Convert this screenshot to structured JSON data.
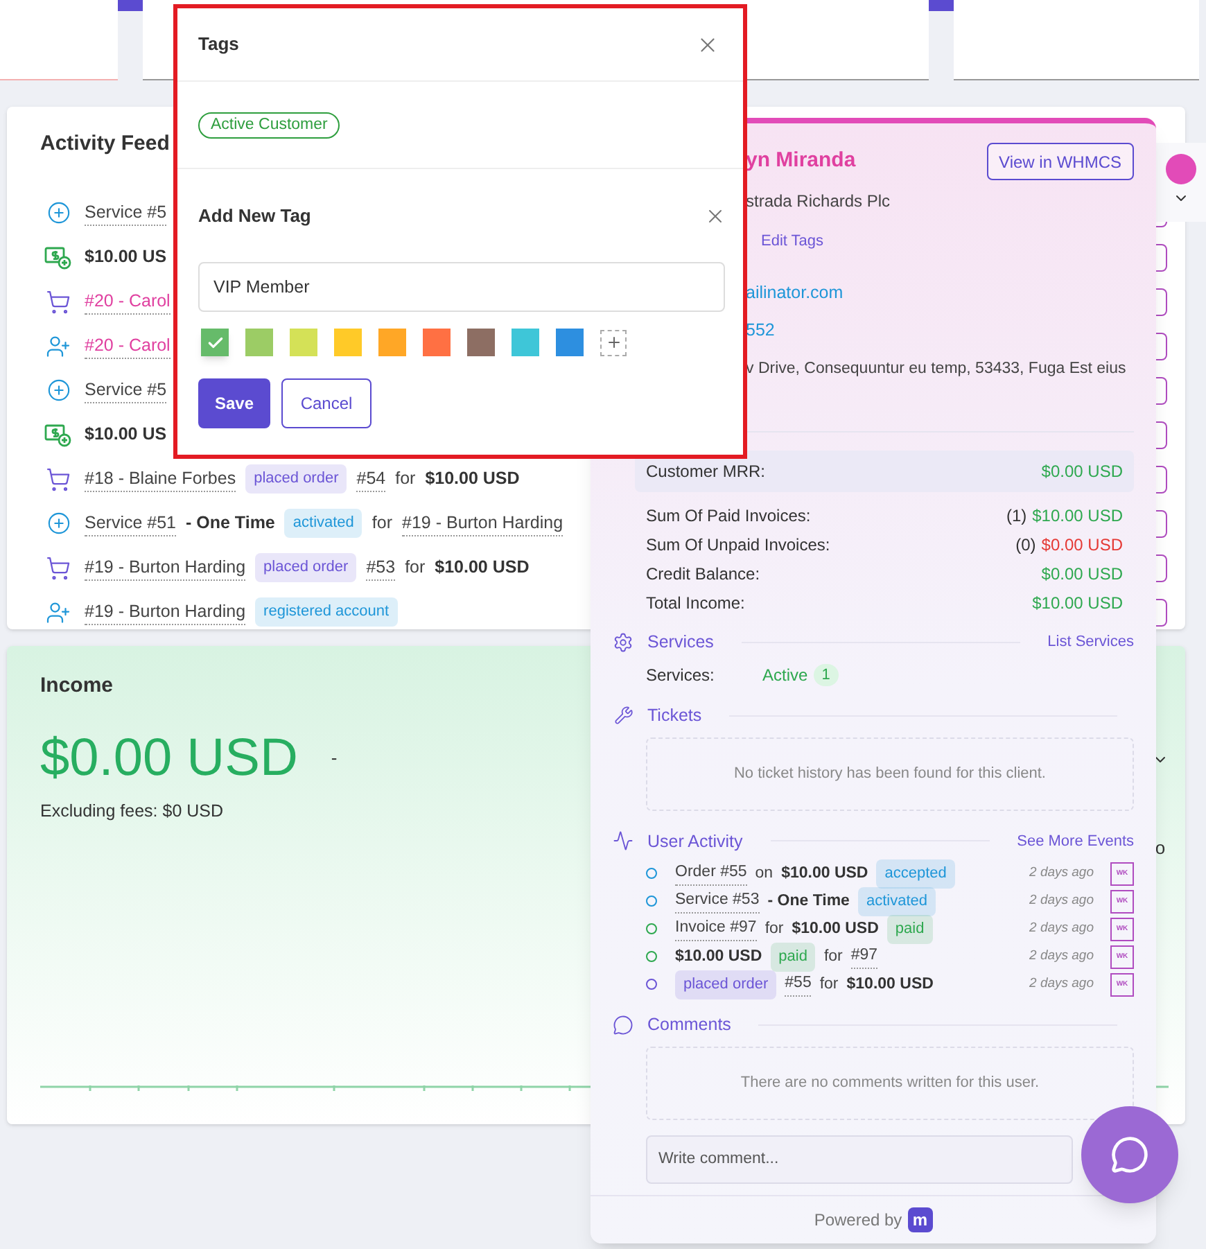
{
  "activity_feed": {
    "title": "Activity Feed",
    "items": [
      {
        "kind": "service",
        "parts": [
          {
            "kind": "link",
            "text": "Service #5"
          }
        ]
      },
      {
        "kind": "payment",
        "parts": [
          {
            "kind": "bold",
            "text": "$10.00 US"
          }
        ]
      },
      {
        "kind": "order",
        "parts": [
          {
            "kind": "link",
            "text": "#20 - Carol",
            "color": "#e040a0"
          }
        ]
      },
      {
        "kind": "user",
        "parts": [
          {
            "kind": "link",
            "text": "#20 - Carol",
            "color": "#e040a0"
          }
        ]
      },
      {
        "kind": "service",
        "parts": [
          {
            "kind": "link",
            "text": "Service #5"
          }
        ]
      },
      {
        "kind": "payment",
        "parts": [
          {
            "kind": "bold",
            "text": "$10.00 US"
          }
        ]
      },
      {
        "kind": "order",
        "parts": [
          {
            "kind": "link",
            "text": "#18 - Blaine Forbes"
          },
          {
            "kind": "badge",
            "text": "placed order",
            "color": "#6b55d6"
          },
          {
            "kind": "link",
            "text": "#54"
          },
          {
            "kind": "text",
            "text": "for"
          },
          {
            "kind": "bold",
            "text": "$10.00 USD"
          }
        ]
      },
      {
        "kind": "service",
        "parts": [
          {
            "kind": "link",
            "text": "Service #51"
          },
          {
            "kind": "bold",
            "text": "- One Time"
          },
          {
            "kind": "badge",
            "text": "activated",
            "color": "#1e96d8"
          },
          {
            "kind": "text",
            "text": "for"
          },
          {
            "kind": "link",
            "text": "#19 - Burton Harding"
          }
        ]
      },
      {
        "kind": "order",
        "parts": [
          {
            "kind": "link",
            "text": "#19 - Burton Harding"
          },
          {
            "kind": "badge",
            "text": "placed order",
            "color": "#6b55d6"
          },
          {
            "kind": "link",
            "text": "#53"
          },
          {
            "kind": "text",
            "text": "for"
          },
          {
            "kind": "bold",
            "text": "$10.00 USD"
          }
        ]
      },
      {
        "kind": "user",
        "parts": [
          {
            "kind": "link",
            "text": "#19 - Burton Harding"
          },
          {
            "kind": "badge",
            "text": "registered account",
            "color": "#1e96d8"
          }
        ]
      }
    ]
  },
  "income": {
    "title": "Income",
    "amount": "$0.00 USD",
    "dash": "-",
    "note": "Excluding fees: $0 USD",
    "side_text": "o"
  },
  "tags_modal": {
    "title": "Tags",
    "tags": [
      {
        "label": "Active Customer",
        "color": "#2e9e3e"
      }
    ],
    "add_title": "Add New Tag",
    "input_value": "VIP Member",
    "swatches": [
      {
        "color": "#66bb6a",
        "selected": true
      },
      {
        "color": "#9ccc65",
        "selected": false
      },
      {
        "color": "#d4e157",
        "selected": false
      },
      {
        "color": "#ffca28",
        "selected": false
      },
      {
        "color": "#ffa726",
        "selected": false
      },
      {
        "color": "#ff7043",
        "selected": false
      },
      {
        "color": "#8d6e63",
        "selected": false
      },
      {
        "color": "#3ec6d8",
        "selected": false
      },
      {
        "color": "#2d8fe0",
        "selected": false
      }
    ],
    "save": "Save",
    "cancel": "Cancel"
  },
  "client_panel": {
    "name": "yn Miranda",
    "view_button": "View in WHMCS",
    "company": "strada Richards Plc",
    "edit_tags": "Edit Tags",
    "email": "ailinator.com",
    "phone": "552",
    "address": "v Drive, Consequuntur eu temp, 53433, Fuga Est eius",
    "mrr": {
      "label": "Customer MRR:",
      "value": "$0.00 USD",
      "color": "#2ea84f"
    },
    "stats": [
      {
        "label": "Sum Of Paid Invoices:",
        "count": "(1)",
        "value": "$10.00 USD",
        "color": "#2ea84f"
      },
      {
        "label": "Sum Of Unpaid Invoices:",
        "count": "(0)",
        "value": "$0.00 USD",
        "color": "#e53935"
      },
      {
        "label": "Credit Balance:",
        "value": "$0.00 USD",
        "color": "#2ea84f"
      },
      {
        "label": "Total Income:",
        "value": "$10.00 USD",
        "color": "#2ea84f"
      }
    ],
    "services": {
      "title": "Services",
      "link": "List Services",
      "label": "Services:",
      "status": "Active",
      "count": "1"
    },
    "tickets": {
      "title": "Tickets",
      "empty": "No ticket history has been found for this client."
    },
    "user_activity": {
      "title": "User Activity",
      "link": "See More Events",
      "items": [
        {
          "color": "#1e96d8",
          "time": "2 days ago",
          "avatar": "WK",
          "parts": [
            {
              "kind": "link",
              "text": "Order #55"
            },
            {
              "kind": "text",
              "text": "on"
            },
            {
              "kind": "bold",
              "text": "$10.00 USD"
            },
            {
              "kind": "badge",
              "text": "accepted",
              "color": "#1e96d8"
            }
          ]
        },
        {
          "color": "#1e96d8",
          "time": "2 days ago",
          "avatar": "WK",
          "parts": [
            {
              "kind": "link",
              "text": "Service #53"
            },
            {
              "kind": "bold",
              "text": "- One Time"
            },
            {
              "kind": "badge",
              "text": "activated",
              "color": "#1e96d8"
            }
          ]
        },
        {
          "color": "#2ea84f",
          "time": "2 days ago",
          "avatar": "WK",
          "parts": [
            {
              "kind": "link",
              "text": "Invoice #97"
            },
            {
              "kind": "text",
              "text": "for"
            },
            {
              "kind": "bold",
              "text": "$10.00 USD"
            },
            {
              "kind": "badge",
              "text": "paid",
              "color": "#2ea84f"
            }
          ]
        },
        {
          "color": "#2ea84f",
          "time": "2 days ago",
          "avatar": "WK",
          "parts": [
            {
              "kind": "bold",
              "text": "$10.00 USD"
            },
            {
              "kind": "badge",
              "text": "paid",
              "color": "#2ea84f"
            },
            {
              "kind": "text",
              "text": "for"
            },
            {
              "kind": "link",
              "text": "#97"
            }
          ]
        },
        {
          "color": "#6b55d6",
          "time": "2 days ago",
          "avatar": "WK",
          "parts": [
            {
              "kind": "badge",
              "text": "placed order",
              "color": "#6b55d6"
            },
            {
              "kind": "link",
              "text": "#55"
            },
            {
              "kind": "text",
              "text": "for"
            },
            {
              "kind": "bold",
              "text": "$10.00 USD"
            }
          ]
        }
      ]
    },
    "comments": {
      "title": "Comments",
      "empty": "There are no comments written for this user.",
      "placeholder": "Write comment..."
    },
    "powered_by": "Powered by",
    "logo_letter": "m"
  }
}
